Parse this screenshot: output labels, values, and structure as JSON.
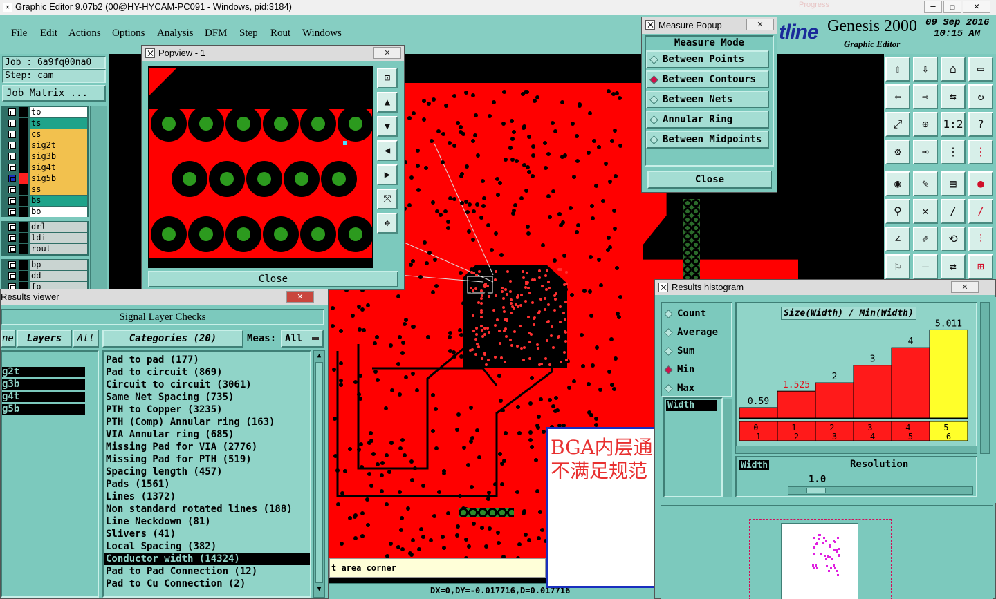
{
  "app": {
    "title": "Graphic Editor 9.07b2 (00@HY-HYCAM-PC091 - Windows, pid:3184)",
    "brand": "Genesis 2000",
    "brand_logo_partial": "tline",
    "brand_sub": "Graphic Editor",
    "date": "09 Sep 2016",
    "time": "10:15 AM",
    "ghost_title": "Progress"
  },
  "menu": [
    "File",
    "Edit",
    "Actions",
    "Options",
    "Analysis",
    "DFM",
    "Step",
    "Rout",
    "Windows"
  ],
  "job": {
    "job_label": "Job : 6a9fq00na0",
    "step_label": "Step: cam",
    "matrix_button": "Job Matrix ..."
  },
  "layers": [
    {
      "name": "to",
      "color": "#ffffff"
    },
    {
      "name": "ts",
      "color": "#1fa38a"
    },
    {
      "name": "cs",
      "color": "#f2c14e"
    },
    {
      "name": "sig2t",
      "color": "#f2c14e"
    },
    {
      "name": "sig3b",
      "color": "#f2c14e"
    },
    {
      "name": "sig4t",
      "color": "#f2c14e"
    },
    {
      "name": "sig5b",
      "color": "#f2c14e",
      "active": true
    },
    {
      "name": "ss",
      "color": "#f2c14e"
    },
    {
      "name": "bs",
      "color": "#1fa38a"
    },
    {
      "name": "bo",
      "color": "#ffffff"
    }
  ],
  "layers2": [
    "drl",
    "ldi",
    "rout"
  ],
  "layers3": [
    "bp",
    "dd",
    "fp"
  ],
  "popview": {
    "title": "Popview - 1",
    "close_label": "Close"
  },
  "measure": {
    "title": "Measure Popup",
    "header": "Measure Mode",
    "options": [
      "Between Points",
      "Between Contours",
      "Between Nets",
      "Annular Ring",
      "Between Midpoints"
    ],
    "selected": 1,
    "close_label": "Close"
  },
  "results_viewer": {
    "title": "Results viewer",
    "panel_title": "Signal Layer Checks",
    "tab_partial": "ne",
    "layers_label": "Layers",
    "all_label": "All",
    "layer_list": [
      "g2t",
      "g3b",
      "g4t",
      "g5b"
    ],
    "categories_label": "Categories (20)",
    "meas_label": "Meas:",
    "meas_value": "All",
    "categories": [
      "Pad to pad (177)",
      "Pad to circuit (869)",
      "Circuit to circuit (3061)",
      "Same Net Spacing (735)",
      "PTH to Copper (3235)",
      "PTH (Comp) Annular ring (163)",
      "VIA Annular ring (685)",
      "Missing Pad for VIA (2776)",
      "Missing Pad for PTH (519)",
      "Spacing length (457)",
      "Pads (1561)",
      "Lines (1372)",
      "Non standard rotated lines (188)",
      "Line Neckdown (81)",
      "Slivers (41)",
      "Local Spacing (382)",
      "Conductor width (14324)",
      "Pad to Pad Connection (12)",
      "Pad to Cu Connection (2)"
    ],
    "selected_category": 16
  },
  "status": {
    "hint": "t area corner",
    "coords": "DX=0,DY=-0.017716,D=0.017716"
  },
  "annotation": {
    "line1": "BGA内层通道",
    "line2": "不满足规范"
  },
  "histogram": {
    "title": "Results histogram",
    "stats": [
      "Count",
      "Average",
      "Sum",
      "Min",
      "Max"
    ],
    "selected_stat": 3,
    "chart_title": "Size(Width) / Min(Width)",
    "field_label": "Width",
    "field_label2": "Width",
    "resolution_label": "Resolution",
    "resolution_value": "1.0"
  },
  "chart_data": {
    "type": "bar",
    "title": "Size(Width) / Min(Width)",
    "categories": [
      "0-1",
      "1-2",
      "2-3",
      "3-4",
      "4-5",
      "5-6"
    ],
    "values": [
      0.59,
      1.525,
      2,
      3,
      4,
      5.011
    ],
    "value_labels": [
      "0.59",
      "1.525",
      "2",
      "3",
      "4",
      "5.011"
    ],
    "bar_colors": [
      "#ff1a1a",
      "#ff1a1a",
      "#ff1a1a",
      "#ff1a1a",
      "#ff1a1a",
      "#ffff2a"
    ],
    "label_colors": [
      "#000000",
      "#e0101a",
      "#000000",
      "#000000",
      "#000000",
      "#000000"
    ],
    "ylim": [
      0,
      5.5
    ]
  }
}
